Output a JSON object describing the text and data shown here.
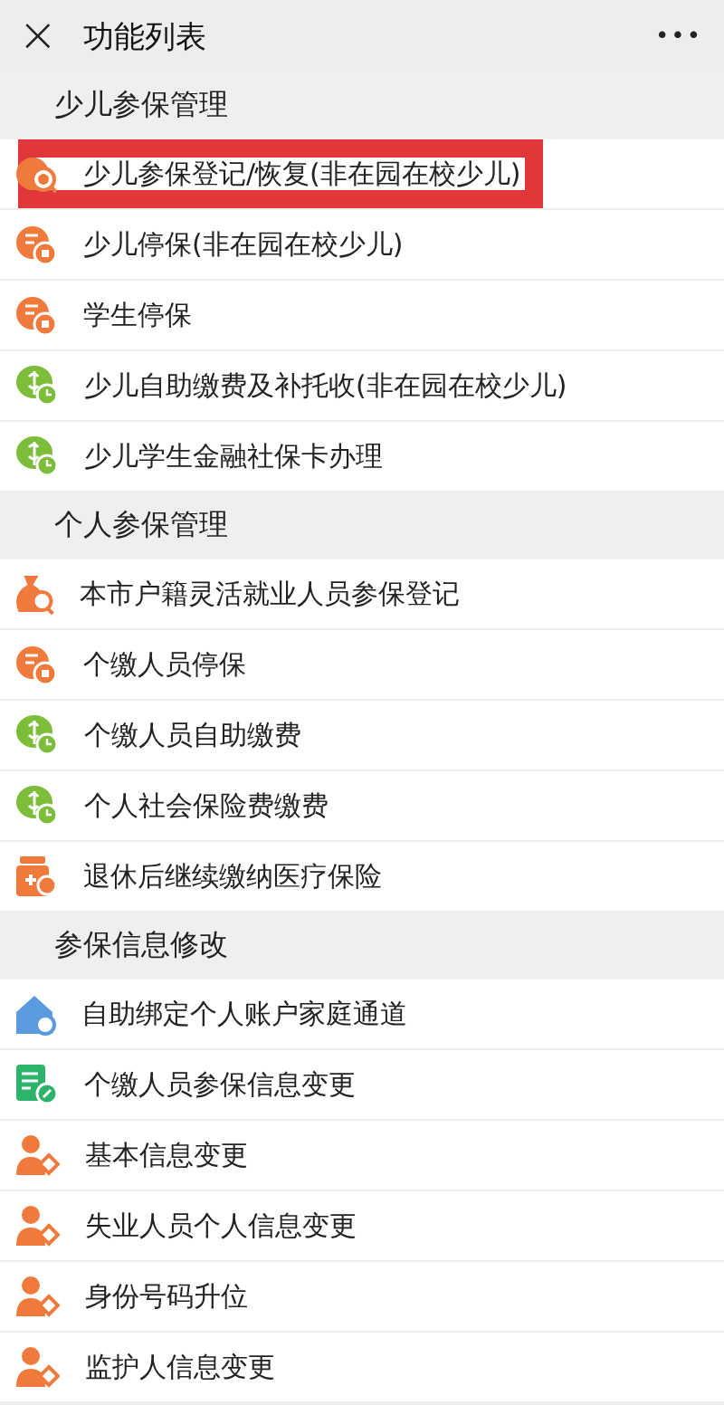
{
  "window": {
    "close": "×",
    "title": "功能列表",
    "more": "•••"
  },
  "sections": [
    {
      "title": "少儿参保管理",
      "items": [
        {
          "label": "少儿参保登记/恢复(非在园在校少儿)",
          "kind": "search",
          "highlighted": true
        },
        {
          "label": "少儿停保(非在园在校少儿)",
          "kind": "pause",
          "highlighted": false
        },
        {
          "label": "学生停保",
          "kind": "pause",
          "highlighted": false
        },
        {
          "label": "少儿自助缴费及补托收(非在园在校少儿)",
          "kind": "coin",
          "highlighted": false
        },
        {
          "label": "少儿学生金融社保卡办理",
          "kind": "coin",
          "highlighted": false
        }
      ]
    },
    {
      "title": "个人参保管理",
      "items": [
        {
          "label": "本市户籍灵活就业人员参保登记",
          "kind": "bag",
          "highlighted": false
        },
        {
          "label": "个缴人员停保",
          "kind": "pause",
          "highlighted": false
        },
        {
          "label": "个缴人员自助缴费",
          "kind": "coin",
          "highlighted": false
        },
        {
          "label": "个人社会保险费缴费",
          "kind": "coin",
          "highlighted": false
        },
        {
          "label": "退休后继续缴纳医疗保险",
          "kind": "medicine",
          "highlighted": false
        }
      ]
    },
    {
      "title": "参保信息修改",
      "items": [
        {
          "label": "自助绑定个人账户家庭通道",
          "kind": "house",
          "highlighted": false
        },
        {
          "label": "个缴人员参保信息变更",
          "kind": "form",
          "highlighted": false
        },
        {
          "label": "基本信息变更",
          "kind": "person",
          "highlighted": false
        },
        {
          "label": "失业人员个人信息变更",
          "kind": "person",
          "highlighted": false
        },
        {
          "label": "身份号码升位",
          "kind": "person",
          "highlighted": false
        },
        {
          "label": "监护人信息变更",
          "kind": "person",
          "highlighted": false
        }
      ]
    }
  ]
}
